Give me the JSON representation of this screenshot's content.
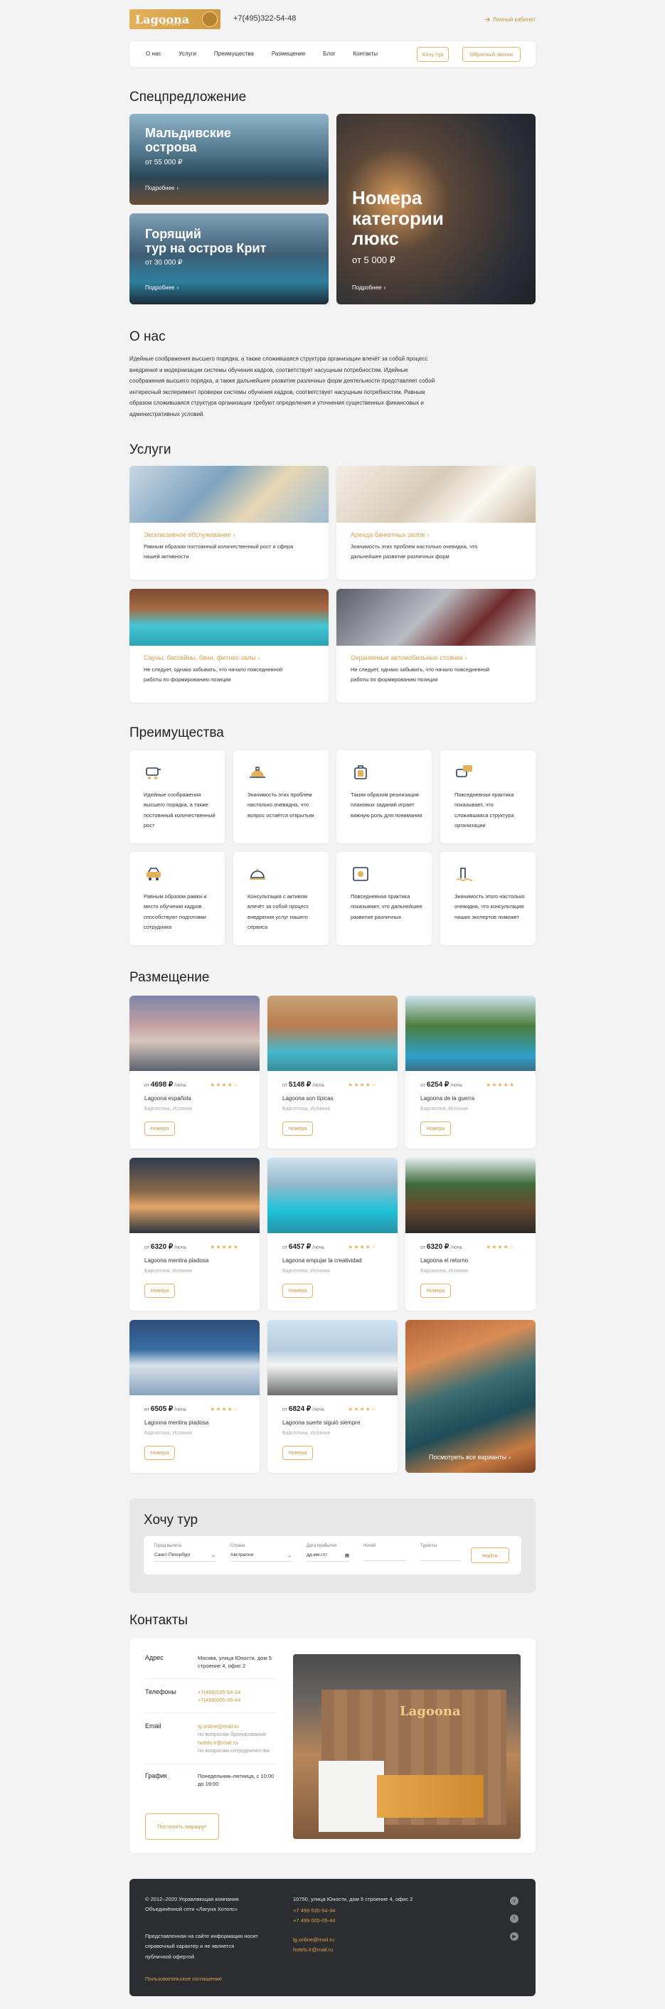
{
  "header": {
    "logo": "Lagoona",
    "logo_sub": "HOTELS",
    "phone": "+7(495)322-54-48",
    "cabinet": "Личный кабинет"
  },
  "nav": {
    "items": [
      "О нас",
      "Услуги",
      "Преимущества",
      "Размещение",
      "Блог",
      "Контакты"
    ],
    "tour_btn": "Хочу тур",
    "callback_btn": "Обратный звонок"
  },
  "offers": {
    "title": "Спецпредложение",
    "cards": [
      {
        "title_1": "Мальдивские",
        "title_2": "острова",
        "price": "от 55 000 ₽",
        "more": "Подробнее"
      },
      {
        "title_1": "Горящий",
        "title_2": "тур на остров Крит",
        "price": "от 30 000 ₽",
        "more": "Подробнее"
      },
      {
        "title_1": "Номера",
        "title_2": "категории",
        "title_3": "люкс",
        "price": "от 5 000 ₽",
        "more": "Подробнее"
      }
    ]
  },
  "about": {
    "title": "О нас",
    "text": "Идейные соображения высшего порядка, а также сложившаяся структура организации влечёт за собой процесс внедрения и модернизации системы обучения кадров, соответствует насущным потребностям. Идейные соображения высшего порядка, а также дальнейшее развитие различных форм деятельности представляет собой интересный эксперимент проверки системы обучения кадров, соответствует насущным потребностям. Равным образом сложившаяся структура организации требуют определения и уточнения существенных финансовых и административных условий."
  },
  "services": {
    "title": "Услуги",
    "items": [
      {
        "name": "Эксклюзивное обслуживание",
        "desc": "Равным образом постоянный количественный рост и сфера нашей активности"
      },
      {
        "name": "Аренда банкетных залов",
        "desc": "Значимость этих проблем настолько очевидна, что дальнейшее развитие различных форм"
      },
      {
        "name": "Сауны, бассейны, бани, фитнес-залы",
        "desc": "Не следует, однако забывать, что начало повседневной работы по формированию позиции"
      },
      {
        "name": "Охраняемые автомобильные стоянки",
        "desc": "Не следует, однако забывать, что начало повседневной работы по формированию позиции"
      }
    ]
  },
  "advantages": {
    "title": "Преимущества",
    "items": [
      {
        "icon": "service-cart-icon",
        "text": "Идейные соображения высшего порядка, а также постоянный количественный рост"
      },
      {
        "icon": "reception-bell-icon",
        "text": "Значимость этих проблем настолько очевидна, что вопрос остаётся открытым"
      },
      {
        "icon": "luggage-icon",
        "text": "Таким образом реализация плановых заданий играет важную роль для понимания"
      },
      {
        "icon": "chat-bubbles-icon",
        "text": "Повседневная практика показывает, что сложившаяся структура организации"
      },
      {
        "icon": "taxi-icon",
        "text": "Равным образом рамки и место обучения кадров способствуют подготовки сотрудника"
      },
      {
        "icon": "cloche-icon",
        "text": "Консультация с активом влечёт за собой процесс внедрения услуг нашего сервиса"
      },
      {
        "icon": "safe-icon",
        "text": "Повседневная практика показывает, что дальнейшее развитие различных"
      },
      {
        "icon": "pool-icon",
        "text": "Значимость этого настолько очевидна, что консультация наших экспертов поможет"
      }
    ]
  },
  "hotels": {
    "title": "Размещение",
    "price_prefix": "от",
    "per_night": "/ночь",
    "more": "Номера",
    "see_all": "Посмотреть все варианты",
    "items": [
      {
        "price": "4698 ₽",
        "stars": "★★★★☆",
        "name": "Lagoona española",
        "city": "Барселона, Испания"
      },
      {
        "price": "5148 ₽",
        "stars": "★★★★☆",
        "name": "Lagoona son típicas",
        "city": "Барселона, Испания"
      },
      {
        "price": "6254 ₽",
        "stars": "★★★★★",
        "name": "Lagoona de la guerra",
        "city": "Барселона, Испания"
      },
      {
        "price": "6320 ₽",
        "stars": "★★★★★",
        "name": "Lagoona mentira piadosa",
        "city": "Барселона, Испания"
      },
      {
        "price": "6457 ₽",
        "stars": "★★★★☆",
        "name": "Lagoona empujar la creatividad",
        "city": "Барселона, Испания"
      },
      {
        "price": "6320 ₽",
        "stars": "★★★★☆",
        "name": "Lagoona el retorno",
        "city": "Барселона, Испания"
      },
      {
        "price": "6505 ₽",
        "stars": "★★★★☆",
        "name": "Lagoona mentira piadosa",
        "city": "Барселона, Испания"
      },
      {
        "price": "6824 ₽",
        "stars": "★★★★☆",
        "name": "Lagoona suerte siguió siempre",
        "city": "Барселона, Испания"
      }
    ]
  },
  "tour": {
    "title": "Хочу тур",
    "fields": [
      {
        "label": "Город вылета",
        "value": "Санкт-Петербург"
      },
      {
        "label": "Страна",
        "value": "Австралия"
      },
      {
        "label": "Дата прибытия",
        "value": "дд.мм.гггг"
      },
      {
        "label": "Ночей",
        "value": ""
      },
      {
        "label": "Туристы",
        "value": ""
      }
    ],
    "submit": "Найти"
  },
  "contacts": {
    "title": "Контакты",
    "address_label": "Адрес",
    "address": "Москва, улица Юности, дом 5 строение 4, офис 2",
    "phone_label": "Телефоны",
    "phones": [
      "+7(499)535-54-34",
      "+7(499)005-05-44"
    ],
    "email_label": "Email",
    "email_1": "lg.online@mail.ru",
    "email_1_note": "по вопросам бронирования",
    "email_2": "hotels.lr@mail.ru",
    "email_2_note": "по вопросам сотрудничества",
    "schedule_label": "График",
    "schedule": "Понедельник–пятница, с 10:00 до 19:00",
    "route_btn": "Построить маршрут",
    "office_sign": "Lagoona"
  },
  "footer": {
    "copyright": "© 2012–2020 Управляющая компания Объединённой сети «Лагуна Хотелс»",
    "address": "10750, улица Юности, дом 5 строение 4, офис 2",
    "phones": [
      "+7 499 535-54-34",
      "+7 499 005-05-44"
    ],
    "disclaimer": "Представленная на сайте информация носит справочный характер и не является публичной офертой",
    "emails": [
      "lg.online@mail.ru",
      "hotels.lr@mail.ru"
    ],
    "agreement": "Пользовательское соглашение"
  },
  "colors": {
    "accent": "#d4a14e",
    "dark": "#2c2d31",
    "bg": "#f3f3f3"
  }
}
